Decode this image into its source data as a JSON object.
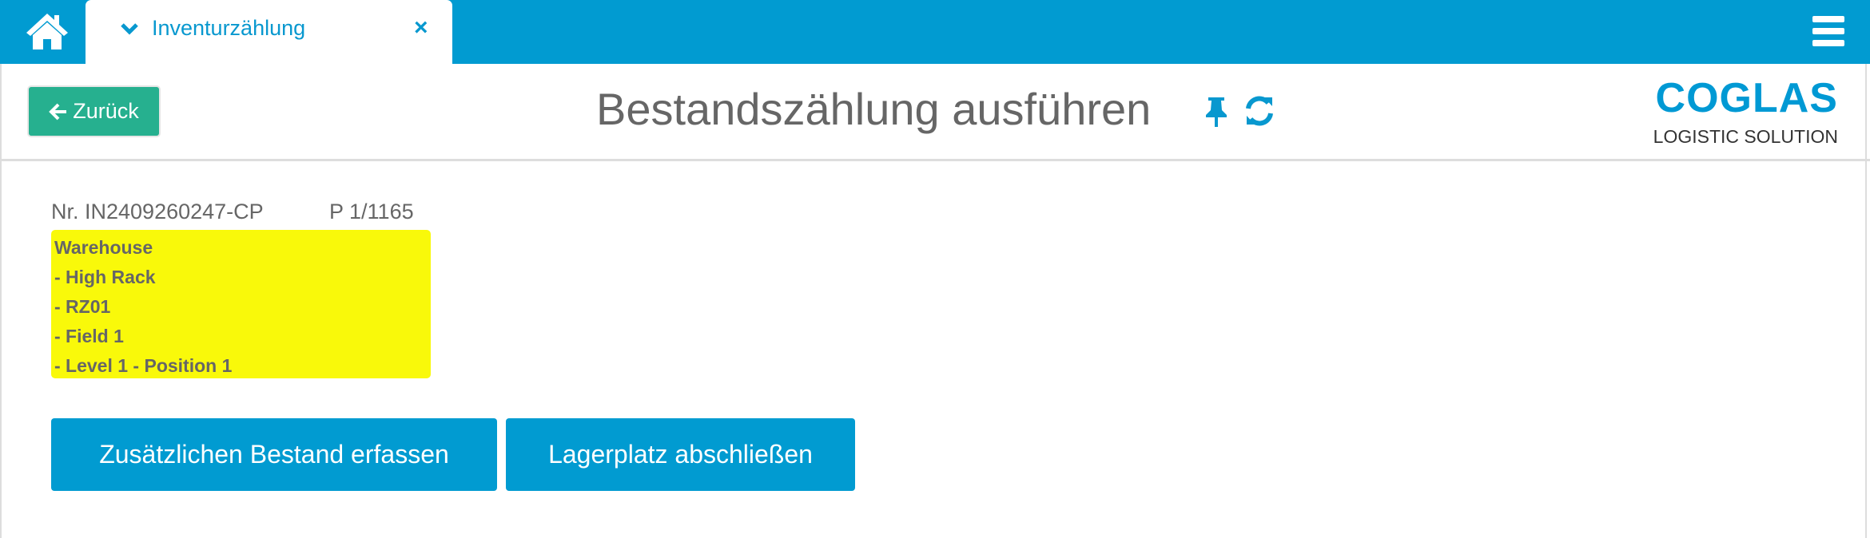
{
  "header": {
    "home_icon": "home-icon",
    "tab": {
      "label": "Inventurzählung",
      "close": "×"
    },
    "menu_icon": "hamburger-icon",
    "accent": "#019bd1"
  },
  "toolbar": {
    "back_label": "Zurück",
    "title": "Bestandszählung ausführen",
    "pin_icon": "thumbtack-icon",
    "refresh_icon": "refresh-icon",
    "back_color": "#26b08f"
  },
  "logo": {
    "name": "COGLAS",
    "tagline": "LOGISTIC SOLUTION"
  },
  "count": {
    "number": "Nr. IN2409260247-CP",
    "position": "P 1/1165",
    "location": [
      "Warehouse",
      "- High Rack",
      "- RZ01",
      "- Field 1",
      "- Level 1 - Position 1"
    ],
    "highlight": "#f9f90a"
  },
  "actions": {
    "add_stock": "Zusätzlichen Bestand erfassen",
    "close_location": "Lagerplatz abschließen"
  }
}
